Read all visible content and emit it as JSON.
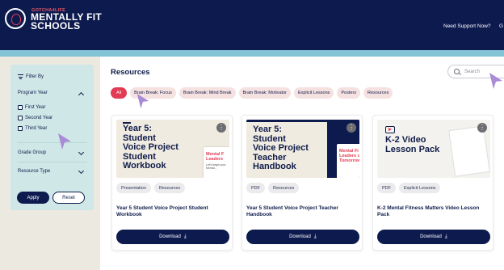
{
  "header": {
    "brand_top": "GOTCHA4LIFE",
    "brand_line1": "MENTALLY FIT",
    "brand_line2": "SCHOOLS",
    "support_link": "Need Support Now?",
    "cut_link": "G"
  },
  "sidebar": {
    "filter_by": "Filter By",
    "program_year": "Program Year",
    "options": [
      "First Year",
      "Second Year",
      "Third Year"
    ],
    "grade_group": "Grade Group",
    "resource_type": "Resource Type",
    "apply": "Apply",
    "reset": "Reset"
  },
  "main": {
    "title": "Resources",
    "search_placeholder": "Search",
    "chips": [
      "All",
      "Brain Break: Focus",
      "Brain Break: Mind Break",
      "Brain Break: Motivator",
      "Explicit Lessons",
      "Posters",
      "Resources"
    ],
    "active_chip": "All"
  },
  "cards": [
    {
      "thumb_title": "Year 5:\nStudent\nVoice Project\nStudent\nWorkbook",
      "thumb_mini": "Mental F\nLeaders",
      "thumb_mini_sub": "Let's begin your Mental...",
      "tags": [
        "Presentation",
        "Resources"
      ],
      "title": "Year 5 Student Voice Project Student Workbook",
      "download": "Download"
    },
    {
      "thumb_title": "Year 5:\nStudent\nVoice Project\nTeacher\nHandbook",
      "thumb_mini": "Mental Fi\nLeaders o\nTomorrow",
      "tags": [
        "PDF",
        "Resources"
      ],
      "title": "Year 5 Student Voice Project Teacher Handbook",
      "download": "Download"
    },
    {
      "thumb_title": "K-2 Video\nLesson Pack",
      "tags": [
        "PDF",
        "Explicit Lessons"
      ],
      "title": "K-2 Mental Fitness Matters Video Lesson Pack",
      "download": "Download"
    }
  ],
  "colors": {
    "navy": "#0d1a4e",
    "accent_red": "#e23b54",
    "band_blue": "#82c3d5",
    "filter_panel": "#cfe7e7",
    "chip_bg": "#f6e1e1",
    "cursor": "#a98bd6"
  },
  "icons": [
    "logo-seal-icon",
    "filter-icon",
    "chevron-up-icon",
    "chevron-down-icon",
    "checkbox-icon",
    "search-icon",
    "more-icon",
    "download-icon",
    "play-icon",
    "cursor-arrow-icon"
  ]
}
